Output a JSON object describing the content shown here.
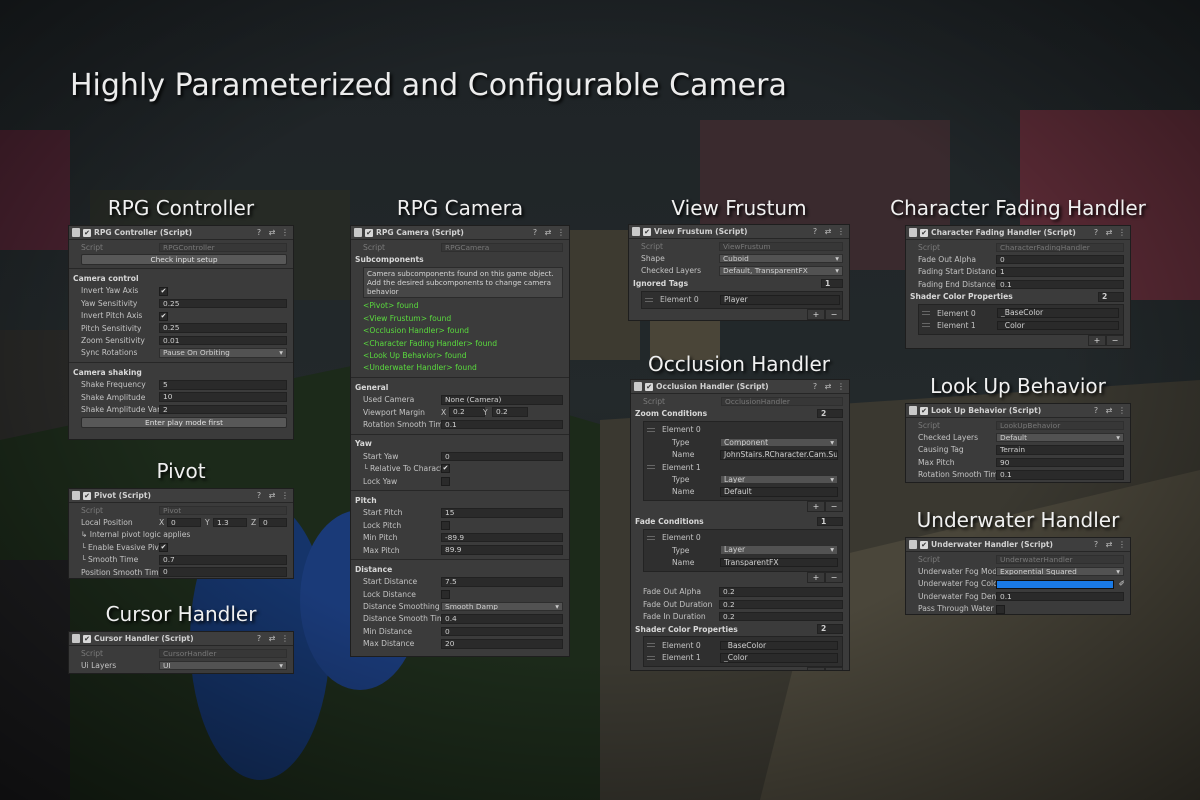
{
  "page_title": "Highly Parameterized and Configurable Camera",
  "icons": {
    "check": "✔",
    "help": "?",
    "settings": "⇄",
    "menu": "⋮",
    "target": "◎",
    "tri_down": "▼"
  },
  "colors": {
    "accent_green": "#5adc3e",
    "fog_color": "#1a7ae6",
    "panel": "#3b3b3b"
  },
  "rpg_controller": {
    "heading": "RPG Controller",
    "header": "RPG Controller (Script)",
    "script_label": "Script",
    "script_value": "RPGController",
    "check_input_button": "Check input setup",
    "camera_control": "Camera control",
    "invert_yaw_label": "Invert Yaw Axis",
    "invert_yaw": true,
    "yaw_sens_label": "Yaw Sensitivity",
    "yaw_sens": "0.25",
    "invert_pitch_label": "Invert Pitch Axis",
    "invert_pitch": true,
    "pitch_sens_label": "Pitch Sensitivity",
    "pitch_sens": "0.25",
    "zoom_sens_label": "Zoom Sensitivity",
    "zoom_sens": "0.01",
    "sync_rot_label": "Sync Rotations",
    "sync_rot": "Pause On Orbiting",
    "camera_shaking": "Camera shaking",
    "shake_freq_label": "Shake Frequency",
    "shake_freq": "5",
    "shake_amp_label": "Shake Amplitude",
    "shake_amp": "10",
    "shake_var_label": "Shake Amplitude Varia",
    "shake_var": "2",
    "play_mode_button": "Enter play mode first"
  },
  "pivot": {
    "heading": "Pivot",
    "header": "Pivot (Script)",
    "script_label": "Script",
    "script_value": "Pivot",
    "local_pos_label": "Local Position",
    "x": "X",
    "x_val": "0",
    "y": "Y",
    "y_val": "1.3",
    "z": "Z",
    "z_val": "0",
    "internal_note": "↳ Internal pivot logic applies",
    "evasive_label": "└ Enable Evasive Pivo",
    "evasive": true,
    "smooth_label": "└ Smooth Time",
    "smooth": "0.7",
    "pos_smooth_label": "Position Smooth Time",
    "pos_smooth": "0"
  },
  "cursor_handler": {
    "heading": "Cursor Handler",
    "header": "Cursor Handler (Script)",
    "script_label": "Script",
    "script_value": "CursorHandler",
    "ui_layers_label": "Ui Layers",
    "ui_layers": "UI"
  },
  "rpg_camera": {
    "heading": "RPG Camera",
    "header": "RPG Camera (Script)",
    "script_label": "Script",
    "script_value": "RPGCamera",
    "subcomponents": "Subcomponents",
    "help_text": "Camera subcomponents found on this game object. Add the desired subcomponents to change camera behavior",
    "found": [
      "<Pivot> found",
      "<View Frustum> found",
      "<Occlusion Handler> found",
      "<Character Fading Handler> found",
      "<Look Up Behavior> found",
      "<Underwater Handler> found"
    ],
    "general": "General",
    "used_camera_label": "Used Camera",
    "used_camera": "None (Camera)",
    "viewport_label": "Viewport Margin",
    "vx": "X",
    "vx_val": "0.2",
    "vy": "Y",
    "vy_val": "0.2",
    "rot_smooth_label": "Rotation Smooth Time",
    "rot_smooth": "0.1",
    "yaw": "Yaw",
    "start_yaw_label": "Start Yaw",
    "start_yaw": "0",
    "rel_char_label": "└ Relative To Charact",
    "rel_char": true,
    "lock_yaw_label": "Lock Yaw",
    "lock_yaw": false,
    "pitch": "Pitch",
    "start_pitch_label": "Start Pitch",
    "start_pitch": "15",
    "lock_pitch_label": "Lock Pitch",
    "lock_pitch": false,
    "min_pitch_label": "Min Pitch",
    "min_pitch": "-89.9",
    "max_pitch_label": "Max Pitch",
    "max_pitch": "89.9",
    "distance": "Distance",
    "start_dist_label": "Start Distance",
    "start_dist": "7.5",
    "lock_dist_label": "Lock Distance",
    "lock_dist": false,
    "dist_smoothing_label": "Distance Smoothing",
    "dist_smoothing": "Smooth Damp",
    "dist_smooth_time_label": "Distance Smooth Time",
    "dist_smooth_time": "0.4",
    "min_dist_label": "Min Distance",
    "min_dist": "0",
    "max_dist_label": "Max Distance",
    "max_dist": "20"
  },
  "view_frustum": {
    "heading": "View Frustum",
    "header": "View Frustum (Script)",
    "script_label": "Script",
    "script_value": "ViewFrustum",
    "shape_label": "Shape",
    "shape": "Cuboid",
    "checked_layers_label": "Checked Layers",
    "checked_layers": "Default, TransparentFX",
    "ignored_tags_label": "Ignored Tags",
    "ignored_tags_count": "1",
    "element0_label": "Element 0",
    "element0": "Player"
  },
  "occlusion": {
    "heading": "Occlusion Handler",
    "header": "Occlusion Handler (Script)",
    "script_label": "Script",
    "script_value": "OcclusionHandler",
    "zoom_cond_label": "Zoom Conditions",
    "zoom_cond_count": "2",
    "z_el0": "Element 0",
    "z_el0_type_label": "Type",
    "z_el0_type": "Component",
    "z_el0_name_label": "Name",
    "z_el0_name": "JohnStairs.RCharacter.Cam.Sub",
    "z_el1": "Element 1",
    "z_el1_type_label": "Type",
    "z_el1_type": "Layer",
    "z_el1_name_label": "Name",
    "z_el1_name": "Default",
    "fade_cond_label": "Fade Conditions",
    "fade_cond_count": "1",
    "f_el0": "Element 0",
    "f_el0_type_label": "Type",
    "f_el0_type": "Layer",
    "f_el0_name_label": "Name",
    "f_el0_name": "TransparentFX",
    "fade_alpha_label": "Fade Out Alpha",
    "fade_alpha": "0.2",
    "fade_out_dur_label": "Fade Out Duration",
    "fade_out_dur": "0.2",
    "fade_in_dur_label": "Fade In Duration",
    "fade_in_dur": "0.2",
    "shader_label": "Shader Color Properties",
    "shader_count": "2",
    "s_el0_label": "Element 0",
    "s_el0": "_BaseColor",
    "s_el1_label": "Element 1",
    "s_el1": "_Color"
  },
  "char_fading": {
    "heading": "Character Fading Handler",
    "header": "Character Fading Handler (Script)",
    "script_label": "Script",
    "script_value": "CharacterFadingHandler",
    "fade_alpha_label": "Fade Out Alpha",
    "fade_alpha": "0",
    "fade_start_label": "Fading Start Distance",
    "fade_start": "1",
    "fade_end_label": "Fading End Distance",
    "fade_end": "0.1",
    "shader_label": "Shader Color Properties",
    "shader_count": "2",
    "s_el0_label": "Element 0",
    "s_el0": "_BaseColor",
    "s_el1_label": "Element 1",
    "s_el1": "_Color"
  },
  "look_up": {
    "heading": "Look Up Behavior",
    "header": "Look Up Behavior (Script)",
    "script_label": "Script",
    "script_value": "LookUpBehavior",
    "checked_layers_label": "Checked Layers",
    "checked_layers": "Default",
    "causing_tag_label": "Causing Tag",
    "causing_tag": "Terrain",
    "max_pitch_label": "Max Pitch",
    "max_pitch": "90",
    "rot_smooth_label": "Rotation Smooth Time",
    "rot_smooth": "0.1"
  },
  "underwater": {
    "heading": "Underwater Handler",
    "header": "Underwater Handler (Script)",
    "script_label": "Script",
    "script_value": "UnderwaterHandler",
    "fog_mode_label": "Underwater Fog Mode",
    "fog_mode": "Exponential Squared",
    "fog_color_label": "Underwater Fog Color",
    "fog_density_label": "Underwater Fog Densi",
    "fog_density": "0.1",
    "pass_through_label": "Pass Through Water Le",
    "pass_through": false
  }
}
